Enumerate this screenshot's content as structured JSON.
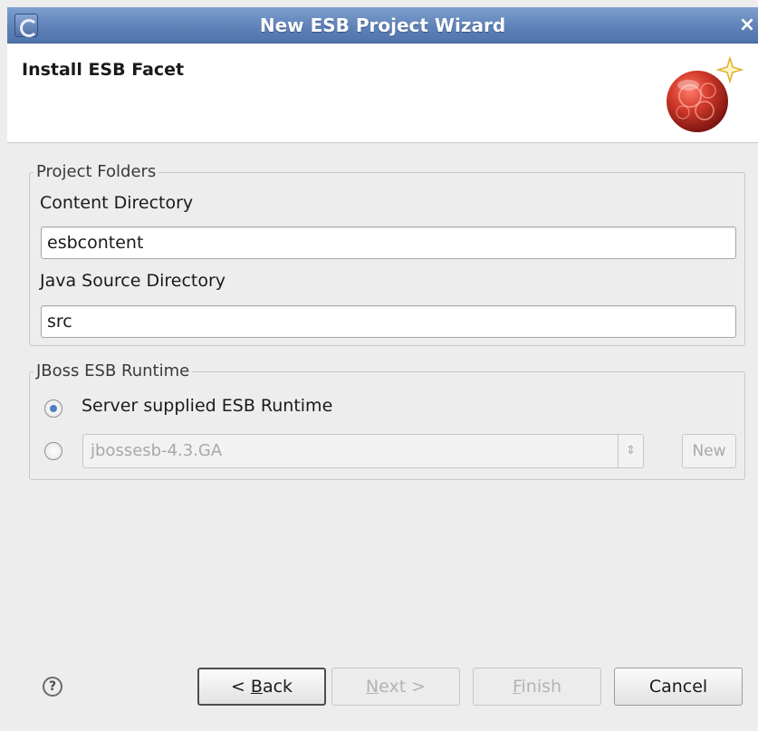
{
  "window": {
    "title": "New ESB Project Wizard",
    "close_glyph": "×"
  },
  "banner": {
    "page_title": "Install ESB Facet",
    "logo_icon": "esb-facet-logo"
  },
  "project_folders": {
    "group_label": "Project Folders",
    "content_dir_label": "Content Directory",
    "content_dir_value": "esbcontent",
    "java_src_label": "Java Source Directory",
    "java_src_value": "src"
  },
  "runtime": {
    "group_label": "JBoss ESB Runtime",
    "option_server_label": "Server supplied ESB Runtime",
    "option_server_checked": true,
    "option_custom_checked": false,
    "runtime_select_value": "jbossesb-4.3.GA",
    "new_button_label": "New"
  },
  "footer": {
    "help_icon": "help-icon",
    "back_prefix": "< ",
    "back_mnemonic": "B",
    "back_rest": "ack",
    "next_mnemonic": "N",
    "next_rest": "ext >",
    "finish_mnemonic": "F",
    "finish_rest": "inish",
    "cancel_label": "Cancel"
  },
  "colors": {
    "titlebar": "#5f82b8",
    "dialog_bg": "#ededed",
    "radio_accent": "#4f7fc0",
    "logo_red": "#c0392b"
  }
}
